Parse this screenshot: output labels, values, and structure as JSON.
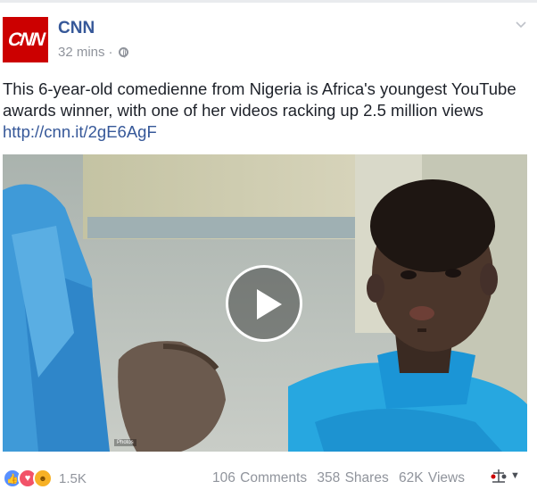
{
  "post": {
    "page_name": "CNN",
    "avatar_text": "CNN",
    "time": "32 mins",
    "separator": "·",
    "text": "This 6-year-old comedienne from Nigeria is Africa's youngest YouTube awards winner, with one of her videos racking up 2.5 million views ",
    "link": "http://cnn.it/2gE6AgF"
  },
  "video": {
    "watermark": "Photos"
  },
  "footer": {
    "reaction_icons": [
      "like-icon",
      "love-icon",
      "haha-icon"
    ],
    "reactions_count": "1.5K",
    "comments": "106 Comments",
    "shares": "358 Shares",
    "views": "62K Views"
  },
  "colors": {
    "link": "#365899",
    "brand": "#cc0000",
    "meta": "#90949c"
  }
}
